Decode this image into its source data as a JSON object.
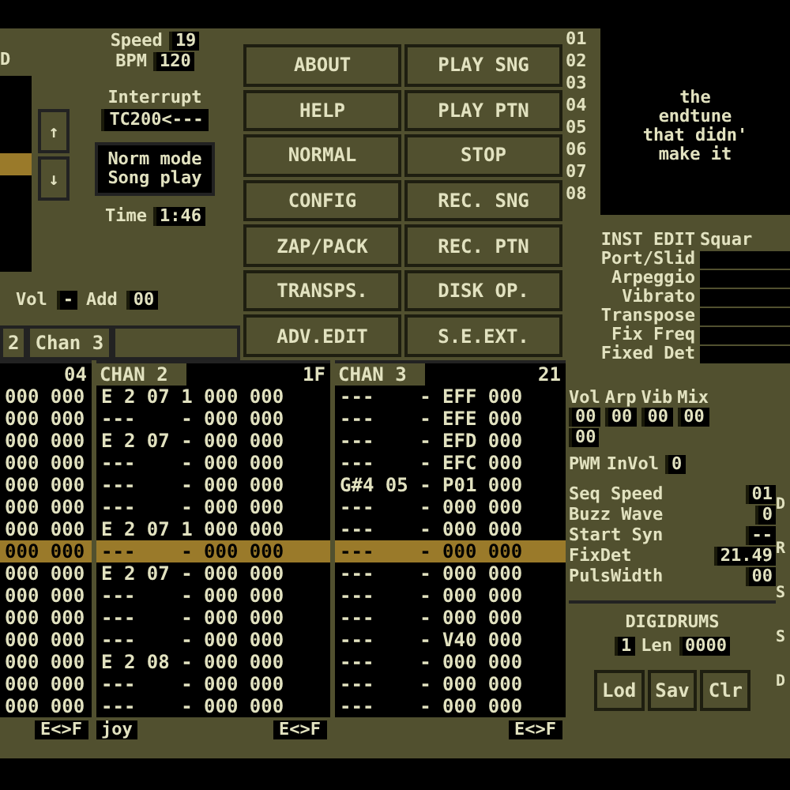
{
  "left_panel": {
    "label": "D",
    "slider": {
      "level": 0.55
    },
    "arrows": [
      "↑",
      "↓"
    ],
    "tempo": [
      {
        "label": "Speed",
        "value": "19"
      },
      {
        "label": "BPM",
        "value": "120"
      }
    ],
    "interrupt": {
      "label": "Interrupt",
      "value": "TC200<---"
    },
    "mode": [
      "Norm mode",
      "Song play"
    ],
    "time": {
      "label": "Time",
      "value": "1:46"
    },
    "volume": {
      "label": "Vol",
      "value": "-"
    },
    "add": {
      "label": "Add",
      "value": "00"
    },
    "channel_strip": [
      "2",
      "Chan 3"
    ]
  },
  "buttons": [
    "ABOUT",
    "PLAY SNG",
    "HELP",
    "PLAY PTN",
    "NORMAL",
    "STOP",
    "CONFIG",
    "REC. SNG",
    "ZAP/PACK",
    "REC. PTN",
    "TRANSPS.",
    "DISK OP.",
    "ADV.EDIT",
    "S.E.EXT."
  ],
  "sequence": [
    "01",
    "02",
    "03",
    "04",
    "05",
    "06",
    "07",
    "08"
  ],
  "song_title": [
    "the",
    "endtune",
    "that didn'",
    "make it"
  ],
  "inst_edit": {
    "title": "INST EDIT",
    "waveform": "Squar",
    "params": [
      "Port/Slid",
      "Arpeggio",
      "Vibrato",
      "Transpose",
      "Fix Freq",
      "Fixed Det"
    ]
  },
  "pattern": {
    "channels": [
      {
        "number": "04",
        "footer": "E<>F"
      },
      {
        "name": "CHAN 2",
        "number": "1F",
        "footer_left": "joy",
        "footer": "E<>F"
      },
      {
        "name": "CHAN 3",
        "number": "21",
        "footer": "E<>F"
      }
    ],
    "rows": [
      {
        "selected": false,
        "cells": [
          "000 000",
          "E 2 07 1 000 000",
          "---    - EFF 000"
        ]
      },
      {
        "selected": false,
        "cells": [
          "000 000",
          "---    - 000 000",
          "---    - EFE 000"
        ]
      },
      {
        "selected": false,
        "cells": [
          "000 000",
          "E 2 07 - 000 000",
          "---    - EFD 000"
        ]
      },
      {
        "selected": false,
        "cells": [
          "000 000",
          "---    - 000 000",
          "---    - EFC 000"
        ]
      },
      {
        "selected": false,
        "cells": [
          "000 000",
          "---    - 000 000",
          "G#4 05 - P01 000"
        ]
      },
      {
        "selected": false,
        "cells": [
          "000 000",
          "---    - 000 000",
          "---    - 000 000"
        ]
      },
      {
        "selected": false,
        "cells": [
          "000 000",
          "E 2 07 1 000 000",
          "---    - 000 000"
        ]
      },
      {
        "selected": true,
        "cells": [
          "000 000",
          "---    - 000 000",
          "---    - 000 000"
        ]
      },
      {
        "selected": false,
        "cells": [
          "000 000",
          "E 2 07 - 000 000",
          "---    - 000 000"
        ]
      },
      {
        "selected": false,
        "cells": [
          "000 000",
          "---    - 000 000",
          "---    - 000 000"
        ]
      },
      {
        "selected": false,
        "cells": [
          "000 000",
          "---    - 000 000",
          "---    - 000 000"
        ]
      },
      {
        "selected": false,
        "cells": [
          "000 000",
          "---    - 000 000",
          "---    - V40 000"
        ]
      },
      {
        "selected": false,
        "cells": [
          "000 000",
          "E 2 08 - 000 000",
          "---    - 000 000"
        ]
      },
      {
        "selected": false,
        "cells": [
          "000 000",
          "---    - 000 000",
          "---    - 000 000"
        ]
      },
      {
        "selected": false,
        "cells": [
          "000 000",
          "---    - 000 000",
          "---    - 000 000"
        ]
      }
    ]
  },
  "instrument": {
    "columns": [
      {
        "label": "Vol",
        "value": "00"
      },
      {
        "label": "Arp",
        "value": "00"
      },
      {
        "label": "Vib",
        "value": "00"
      },
      {
        "label": "Mix",
        "value": "00"
      }
    ],
    "extra_value": "00",
    "pwm_label": "PWM",
    "involume": {
      "label": "InVol",
      "value": "0"
    },
    "settings": [
      {
        "label": "Seq Speed",
        "value": "01"
      },
      {
        "label": "Buzz Wave",
        "value": "0"
      },
      {
        "label": "Start Syn",
        "value": "--"
      },
      {
        "label": "FixDet",
        "value": "21.49"
      },
      {
        "label": "PulsWidth",
        "value": "00"
      }
    ],
    "edge_letters": [
      "D",
      "R",
      "S",
      "S",
      "D"
    ],
    "digidrums": {
      "title": "DIGIDRUMS",
      "number": "1",
      "len_label": "Len",
      "len_value": "0000",
      "buttons": [
        "Lod",
        "Sav",
        "Clr"
      ]
    }
  }
}
